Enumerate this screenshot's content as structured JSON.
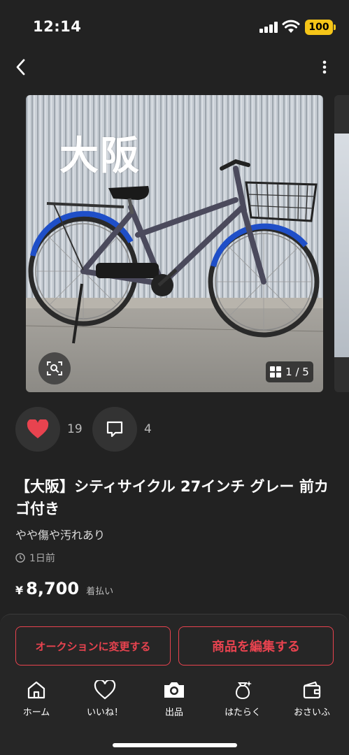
{
  "status": {
    "time": "12:14",
    "battery": "100"
  },
  "gallery": {
    "overlay_text": "大阪",
    "counter": "1 / 5"
  },
  "actions": {
    "likes": "19",
    "comments": "4"
  },
  "product": {
    "title": "【大阪】シティサイクル 27インチ グレー 前カゴ付き",
    "condition": "やや傷や汚れあり",
    "posted": "1日前",
    "currency": "¥",
    "price": "8,700",
    "shipping": "着払い"
  },
  "buttons": {
    "auction": "オークションに変更する",
    "edit": "商品を編集する"
  },
  "tabs": [
    {
      "label": "ホーム",
      "icon": "home-icon"
    },
    {
      "label": "いいね！",
      "icon": "heart-icon"
    },
    {
      "label": "出品",
      "icon": "camera-icon"
    },
    {
      "label": "はたらく",
      "icon": "money-bag-icon"
    },
    {
      "label": "おさいふ",
      "icon": "wallet-icon"
    }
  ],
  "colors": {
    "accent": "#e8434f",
    "background": "#222222",
    "battery": "#f5c518"
  }
}
